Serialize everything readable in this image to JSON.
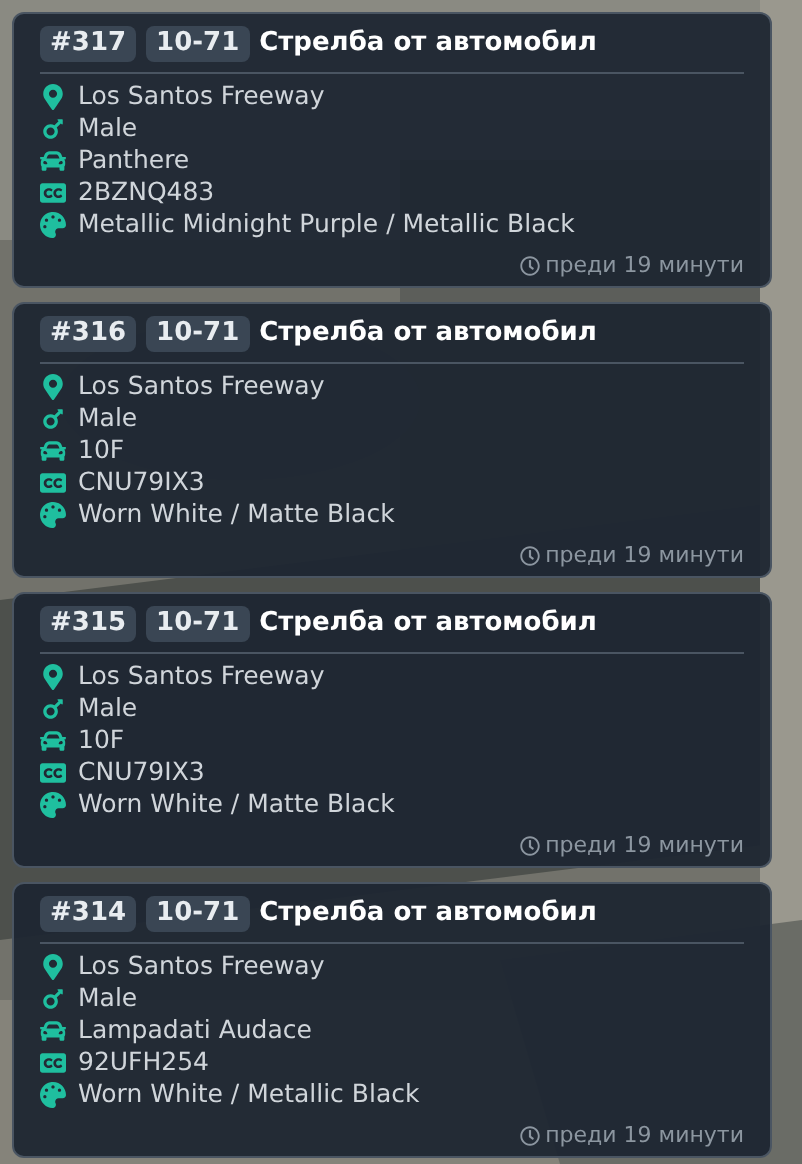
{
  "calls": [
    {
      "id": "#317",
      "code": "10-71",
      "title": "Стрелба от автомобил",
      "details": [
        {
          "kind": "location",
          "text": "Los Santos Freeway"
        },
        {
          "kind": "gender",
          "text": "Male"
        },
        {
          "kind": "vehicle",
          "text": "Panthere"
        },
        {
          "kind": "plate",
          "text": "2BZNQ483"
        },
        {
          "kind": "color",
          "text": "Metallic Midnight Purple / Metallic Black"
        }
      ],
      "time": "преди 19 минути"
    },
    {
      "id": "#316",
      "code": "10-71",
      "title": "Стрелба от автомобил",
      "details": [
        {
          "kind": "location",
          "text": "Los Santos Freeway"
        },
        {
          "kind": "gender",
          "text": "Male"
        },
        {
          "kind": "vehicle",
          "text": "10F"
        },
        {
          "kind": "plate",
          "text": "CNU79IX3"
        },
        {
          "kind": "color",
          "text": "Worn White / Matte Black"
        }
      ],
      "time": "преди 19 минути"
    },
    {
      "id": "#315",
      "code": "10-71",
      "title": "Стрелба от автомобил",
      "details": [
        {
          "kind": "location",
          "text": "Los Santos Freeway"
        },
        {
          "kind": "gender",
          "text": "Male"
        },
        {
          "kind": "vehicle",
          "text": "10F"
        },
        {
          "kind": "plate",
          "text": "CNU79IX3"
        },
        {
          "kind": "color",
          "text": "Worn White / Matte Black"
        }
      ],
      "time": "преди 19 минути"
    },
    {
      "id": "#314",
      "code": "10-71",
      "title": "Стрелба от автомобил",
      "details": [
        {
          "kind": "location",
          "text": "Los Santos Freeway"
        },
        {
          "kind": "gender",
          "text": "Male"
        },
        {
          "kind": "vehicle",
          "text": "Lampadati Audace"
        },
        {
          "kind": "plate",
          "text": "92UFH254"
        },
        {
          "kind": "color",
          "text": "Worn White / Metallic Black"
        }
      ],
      "time": "преди 19 минути"
    }
  ]
}
